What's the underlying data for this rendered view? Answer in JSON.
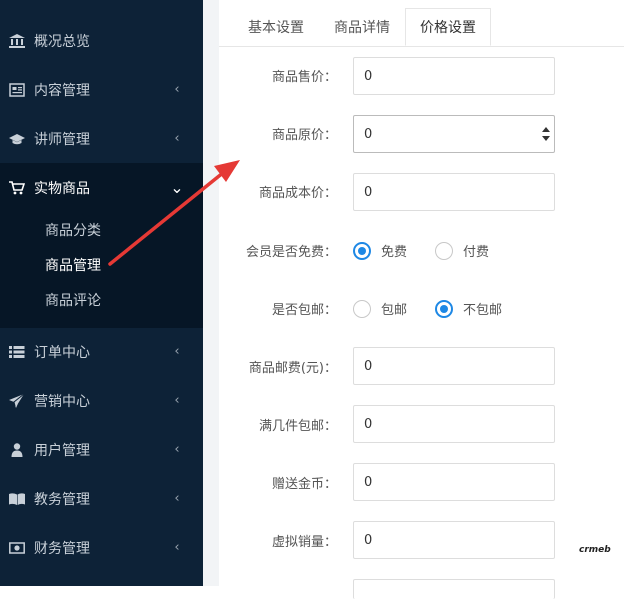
{
  "sidebar": {
    "items": [
      {
        "label": "概况总览",
        "icon": "bank-icon",
        "has_chevron": false
      },
      {
        "label": "内容管理",
        "icon": "newspaper-icon",
        "has_chevron": true
      },
      {
        "label": "讲师管理",
        "icon": "graduation-cap-icon",
        "has_chevron": true
      },
      {
        "label": "实物商品",
        "icon": "cart-icon",
        "has_chevron": true,
        "expanded": true
      },
      {
        "label": "订单中心",
        "icon": "list-icon",
        "has_chevron": true
      },
      {
        "label": "营销中心",
        "icon": "paper-plane-icon",
        "has_chevron": true
      },
      {
        "label": "用户管理",
        "icon": "user-icon",
        "has_chevron": true
      },
      {
        "label": "教务管理",
        "icon": "book-icon",
        "has_chevron": true
      },
      {
        "label": "财务管理",
        "icon": "money-icon",
        "has_chevron": true
      }
    ],
    "submenu": [
      "商品分类",
      "商品管理",
      "商品评论"
    ],
    "chevron_left": "‹",
    "chevron_down": "⌄"
  },
  "tabs": [
    "基本设置",
    "商品详情",
    "价格设置"
  ],
  "active_tab": "价格设置",
  "form": {
    "sale_price": {
      "label": "商品售价：",
      "value": "0"
    },
    "original_price": {
      "label": "商品原价：",
      "value": "0"
    },
    "cost_price": {
      "label": "商品成本价：",
      "value": "0"
    },
    "member_free": {
      "label": "会员是否免费：",
      "options": [
        "免费",
        "付费"
      ],
      "selected": "免费"
    },
    "free_shipping": {
      "label": "是否包邮：",
      "options": [
        "包邮",
        "不包邮"
      ],
      "selected": "不包邮"
    },
    "postage": {
      "label": "商品邮费(元)：",
      "value": "0"
    },
    "free_shipping_qty": {
      "label": "满几件包邮：",
      "value": "0"
    },
    "gift_coins": {
      "label": "赠送金币：",
      "value": "0"
    },
    "virtual_sales": {
      "label": "虚拟销量：",
      "value": "0"
    }
  },
  "watermark": "crmeb",
  "colors": {
    "sidebar_bg": "#0d2237",
    "sidebar_active_bg": "#061626",
    "accent_blue": "#1e88e5",
    "annotation_arrow": "#e53935"
  }
}
